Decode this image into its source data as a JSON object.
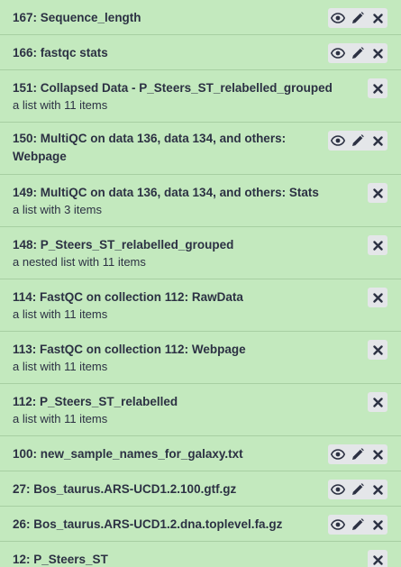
{
  "history": {
    "items": [
      {
        "title": "167: Sequence_length",
        "subtitle": "",
        "actions": [
          "eye-icon",
          "pencil-icon",
          "close-icon"
        ]
      },
      {
        "title": "166: fastqc stats",
        "subtitle": "",
        "actions": [
          "eye-icon",
          "pencil-icon",
          "close-icon"
        ]
      },
      {
        "title": "151: Collapsed Data - P_Steers_ST_relabelled_grouped",
        "subtitle": "a list with 11 items",
        "actions": [
          "close-icon"
        ]
      },
      {
        "title": "150: MultiQC on data 136, data 134, and others: Webpage",
        "subtitle": "",
        "actions": [
          "eye-icon",
          "pencil-icon",
          "close-icon"
        ]
      },
      {
        "title": "149: MultiQC on data 136, data 134, and others: Stats",
        "subtitle": "a list with 3 items",
        "actions": [
          "close-icon"
        ]
      },
      {
        "title": "148: P_Steers_ST_relabelled_grouped",
        "subtitle": "a nested list with 11 items",
        "actions": [
          "close-icon"
        ]
      },
      {
        "title": "114: FastQC on collection 112: RawData",
        "subtitle": "a list with 11 items",
        "actions": [
          "close-icon"
        ]
      },
      {
        "title": "113: FastQC on collection 112: Webpage",
        "subtitle": "a list with 11 items",
        "actions": [
          "close-icon"
        ]
      },
      {
        "title": "112: P_Steers_ST_relabelled",
        "subtitle": "a list with 11 items",
        "actions": [
          "close-icon"
        ]
      },
      {
        "title": "100: new_sample_names_for_galaxy.txt",
        "subtitle": "",
        "actions": [
          "eye-icon",
          "pencil-icon",
          "close-icon"
        ]
      },
      {
        "title": "27: Bos_taurus.ARS-UCD1.2.100.gtf.gz",
        "subtitle": "",
        "actions": [
          "eye-icon",
          "pencil-icon",
          "close-icon"
        ]
      },
      {
        "title": "26: Bos_taurus.ARS-UCD1.2.dna.toplevel.fa.gz",
        "subtitle": "",
        "actions": [
          "eye-icon",
          "pencil-icon",
          "close-icon"
        ]
      },
      {
        "title": "12: P_Steers_ST",
        "subtitle": "",
        "actions": [
          "close-icon"
        ]
      }
    ]
  },
  "colors": {
    "item_background": "#c3e9be",
    "divider": "#a7cfa2",
    "text": "#2c3143",
    "button_background": "#e4e6e9",
    "icon": "#2c3143"
  }
}
